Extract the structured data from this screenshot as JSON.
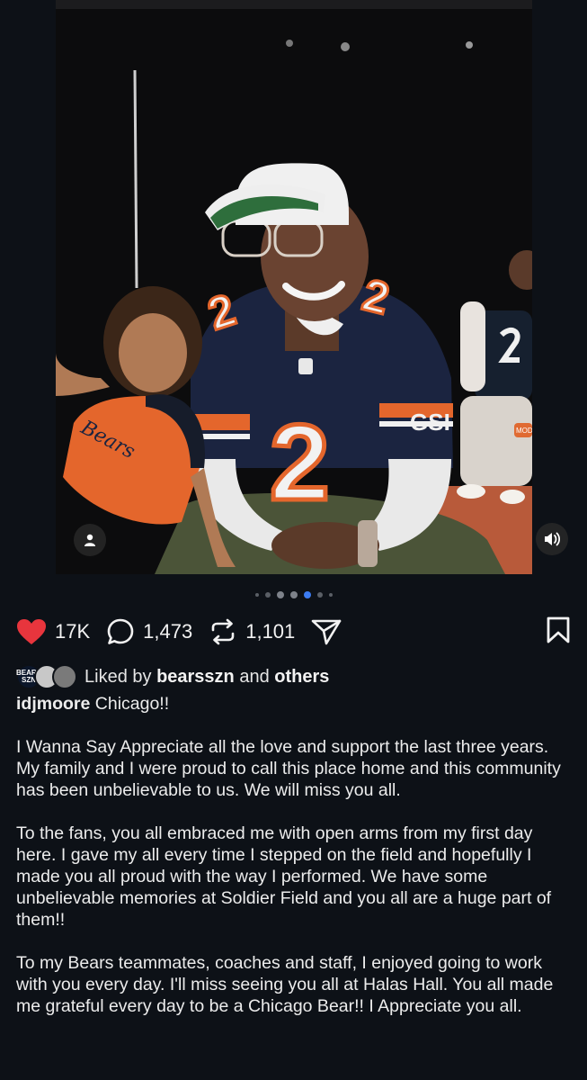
{
  "post": {
    "carousel": {
      "count": 7,
      "active_index": 4
    },
    "actions": {
      "likes": "17K",
      "comments": "1,473",
      "reposts": "1,101"
    },
    "liked_by": {
      "prefix": "Liked by",
      "user": "bearsszn",
      "conjunction": "and",
      "others": "others",
      "avatar_badge": "BEARS SZN"
    },
    "caption": {
      "username": "idjmoore",
      "headline": "Chicago!!",
      "paragraphs": [
        "I Wanna Say Appreciate all the love and support the last three years. My family and I were proud to call this place home and this community has been unbelievable to us. We will miss you all.",
        "To the fans, you all embraced me with open arms from my first day here. I gave my all every time I stepped on the field and hopefully I made you all proud with the way I performed. We have some unbelievable memories at Soldier Field and you all are a huge part of them!!",
        "To my Bears teammates, coaches and staff, I enjoyed going to work with you every day. I'll miss seeing you all at Halas Hall. You all made me grateful every day to be a Chicago Bear!! I Appreciate you all."
      ]
    },
    "photo": {
      "jersey_number": "2",
      "girl_jersey_text": "Bears"
    },
    "colors": {
      "like_red": "#e8353d",
      "carousel_active": "#3c7cf2",
      "bears_navy": "#1b2440",
      "bears_orange": "#e4662c",
      "background": "#0d1117"
    }
  }
}
